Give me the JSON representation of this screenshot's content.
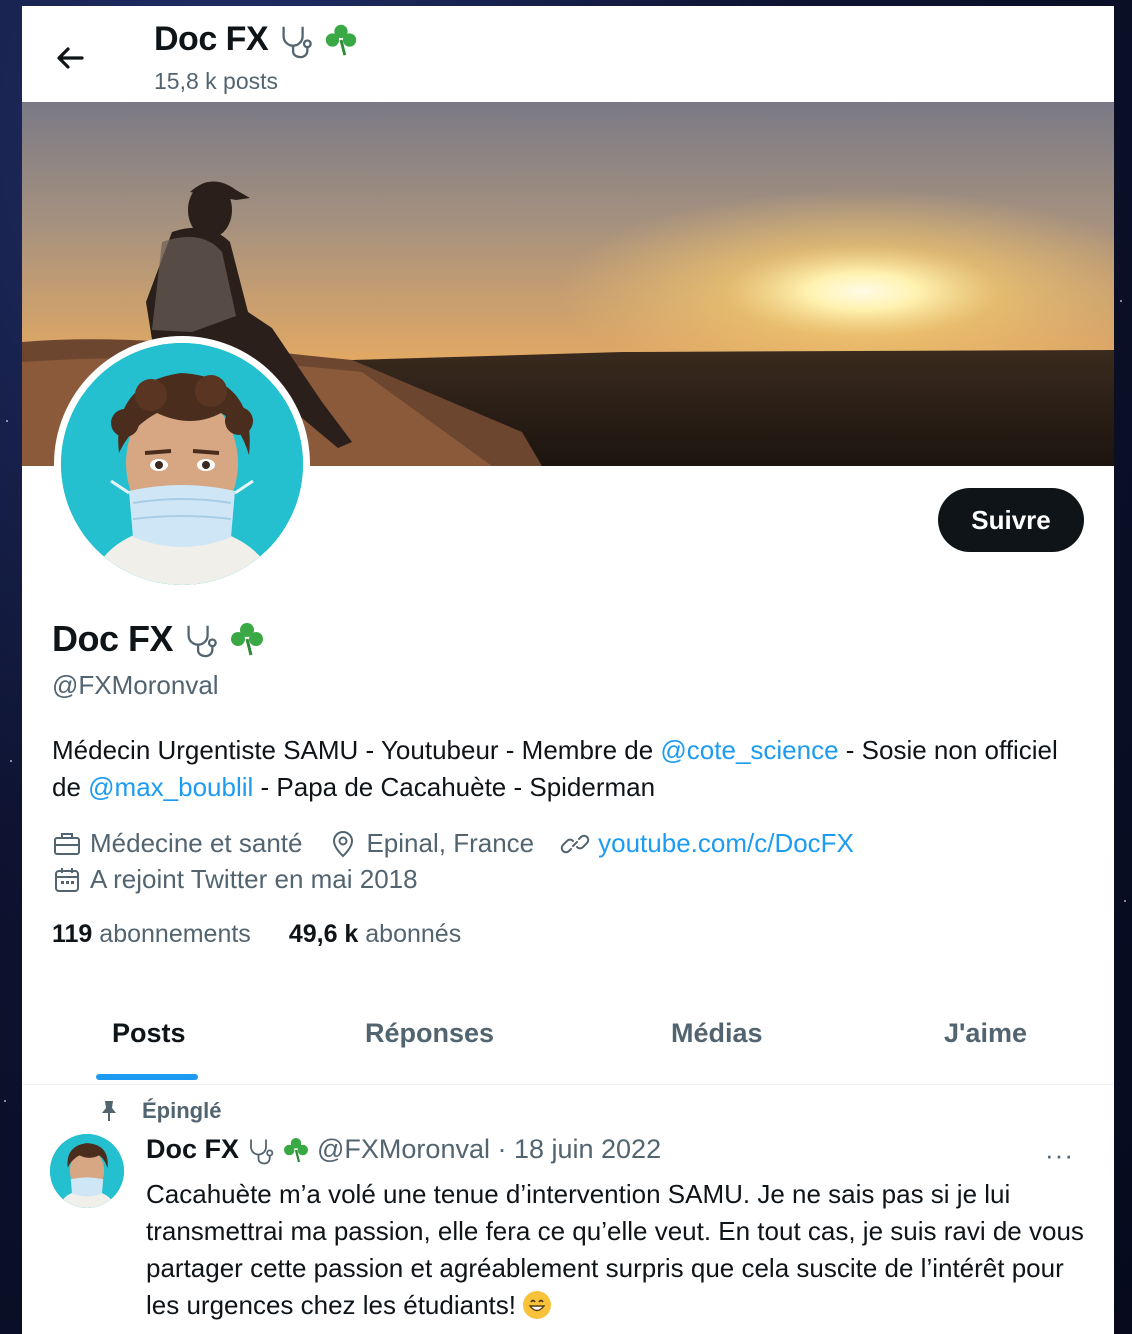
{
  "header": {
    "name": "Doc FX",
    "posts": "15,8 k posts"
  },
  "profile": {
    "name": "Doc FX",
    "handle": "@FXMoronval",
    "follow_label": "Suivre",
    "bio": {
      "part1": "Médecin Urgentiste SAMU - Youtubeur - Membre de ",
      "mention1": "@cote_science",
      "part2": " - Sosie non officiel de ",
      "mention2": "@max_boublil",
      "part3": " - Papa de Cacahuète - Spiderman"
    },
    "category": "Médecine et santé",
    "location": "Epinal, France",
    "website": "youtube.com/c/DocFX",
    "joined": "A rejoint Twitter en mai 2018",
    "following_count": "119",
    "following_label": "abonnements",
    "followers_count": "49,6 k",
    "followers_label": "abonnés"
  },
  "tabs": [
    "Posts",
    "Réponses",
    "Médias",
    "J'aime"
  ],
  "active_tab": "Posts",
  "tweet": {
    "pinned_label": "Épinglé",
    "name": "Doc FX",
    "handle_date": "@FXMoronval · 18 juin 2022",
    "more": "···",
    "text": "Cacahuète m’a volé une tenue d’intervention SAMU. Je ne sais pas si je lui transmettrai ma passion, elle fera ce qu’elle veut. En tout cas, je suis ravi de vous partager cette passion et agréablement surpris que cela suscite de l’intérêt pour les urgences chez les étudiants!"
  },
  "colors": {
    "accent": "#1d9bf0",
    "text": "#0f1419",
    "muted": "#536471",
    "clover": "#3aa845"
  },
  "icons": [
    "back-arrow-icon",
    "stethoscope-icon",
    "shamrock-icon",
    "briefcase-icon",
    "location-pin-icon",
    "link-icon",
    "calendar-icon",
    "pin-icon",
    "grin-emoji-icon"
  ]
}
